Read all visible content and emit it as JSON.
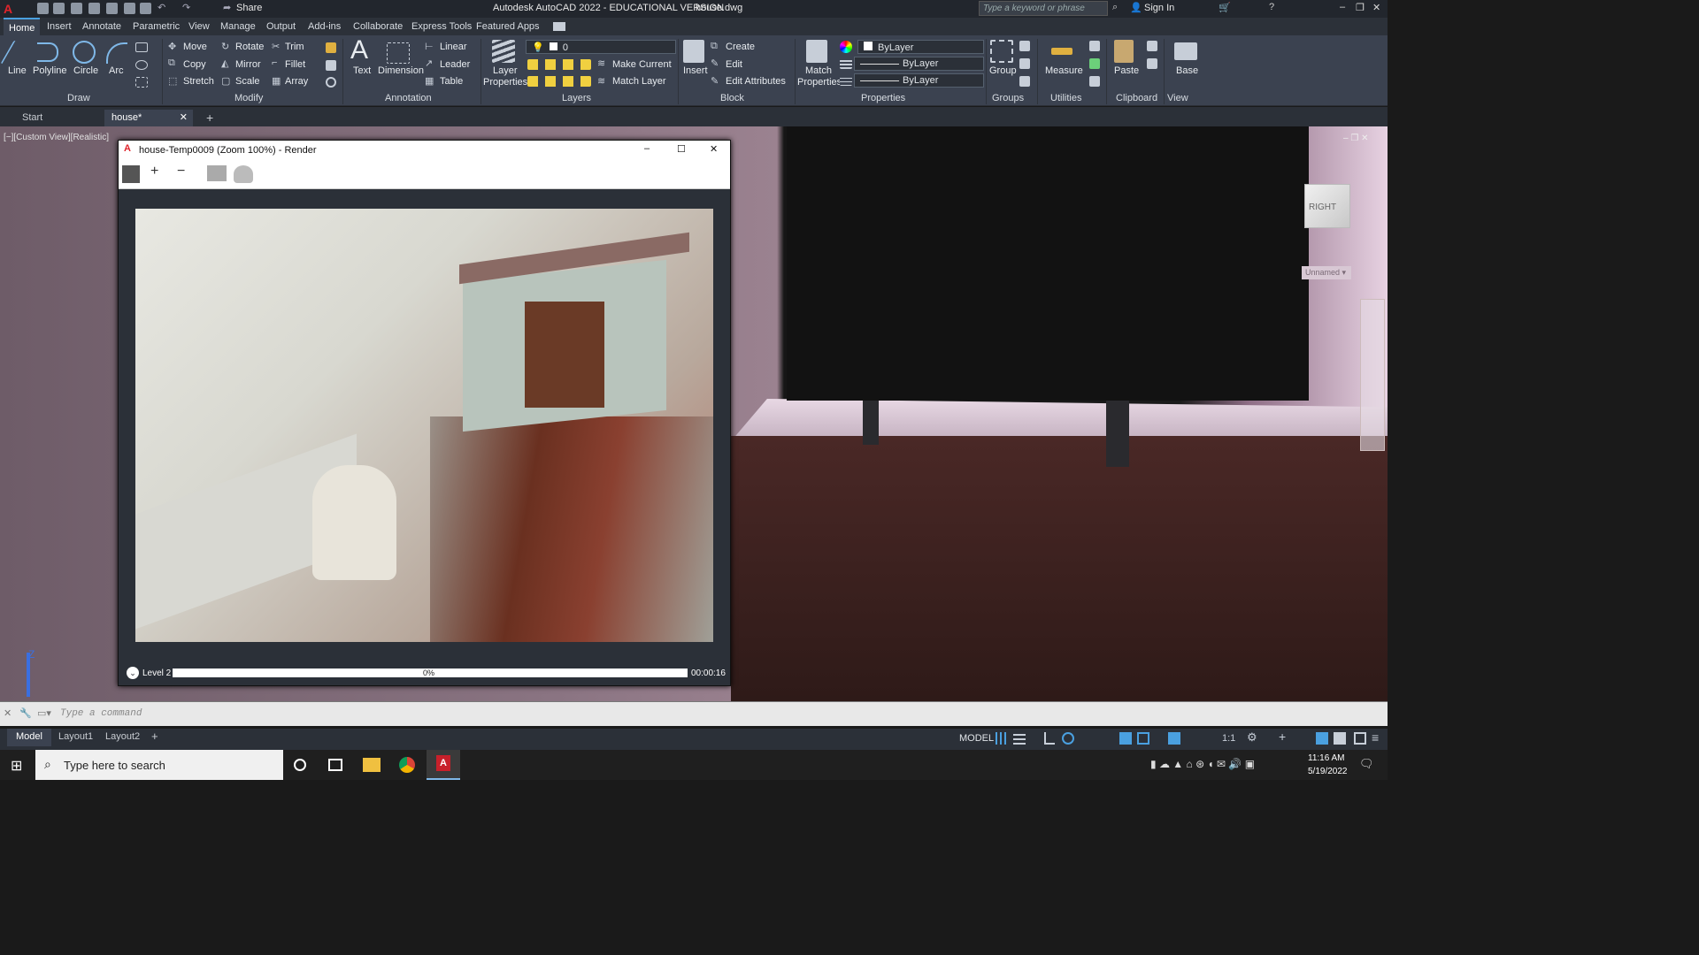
{
  "titlebar": {
    "title": "Autodesk AutoCAD 2022 - EDUCATIONAL VERSION",
    "filename": "house.dwg",
    "share_label": "Share",
    "search_placeholder": "Type a keyword or phrase",
    "sign_in": "Sign In"
  },
  "menu_tabs": [
    "Home",
    "Insert",
    "Annotate",
    "Parametric",
    "View",
    "Manage",
    "Output",
    "Add-ins",
    "Collaborate",
    "Express Tools",
    "Featured Apps"
  ],
  "ribbon": {
    "draw": {
      "title": "Draw",
      "line": "Line",
      "polyline": "Polyline",
      "circle": "Circle",
      "arc": "Arc"
    },
    "modify": {
      "title": "Modify",
      "move": "Move",
      "rotate": "Rotate",
      "trim": "Trim",
      "copy": "Copy",
      "mirror": "Mirror",
      "fillet": "Fillet",
      "stretch": "Stretch",
      "scale": "Scale",
      "array": "Array"
    },
    "annotation": {
      "title": "Annotation",
      "text": "Text",
      "dimension": "Dimension",
      "linear": "Linear",
      "leader": "Leader",
      "table": "Table"
    },
    "layers": {
      "title": "Layers",
      "layer_properties": "Layer Properties",
      "current_layer": "0",
      "make_current": "Make Current",
      "match_layer": "Match Layer"
    },
    "block": {
      "title": "Block",
      "insert": "Insert",
      "create": "Create",
      "edit": "Edit",
      "edit_attributes": "Edit Attributes"
    },
    "properties": {
      "title": "Properties",
      "match_properties": "Match Properties",
      "color": "ByLayer",
      "linetype": "ByLayer",
      "lineweight": "ByLayer"
    },
    "groups": {
      "title": "Groups",
      "group": "Group"
    },
    "utilities": {
      "title": "Utilities",
      "measure": "Measure"
    },
    "clipboard": {
      "title": "Clipboard",
      "paste": "Paste"
    },
    "view": {
      "title": "View",
      "base": "Base"
    }
  },
  "doc_tabs": {
    "start": "Start",
    "active": "house*"
  },
  "viewport": {
    "label": "[−][Custom View][Realistic]",
    "viewcube": "RIGHT",
    "ucs_label": "Unnamed"
  },
  "render_window": {
    "title": "house-Temp0009 (Zoom 100%) - Render",
    "level": "Level 2",
    "progress_text": "0%",
    "progress": 0,
    "elapsed": "00:00:16"
  },
  "command": {
    "placeholder": "Type a command"
  },
  "layout_tabs": [
    "Model",
    "Layout1",
    "Layout2"
  ],
  "statusbar": {
    "model": "MODEL",
    "scale": "1:1"
  },
  "taskbar": {
    "search": "Type here to search",
    "time": "11:16 AM",
    "date": "5/19/2022"
  }
}
